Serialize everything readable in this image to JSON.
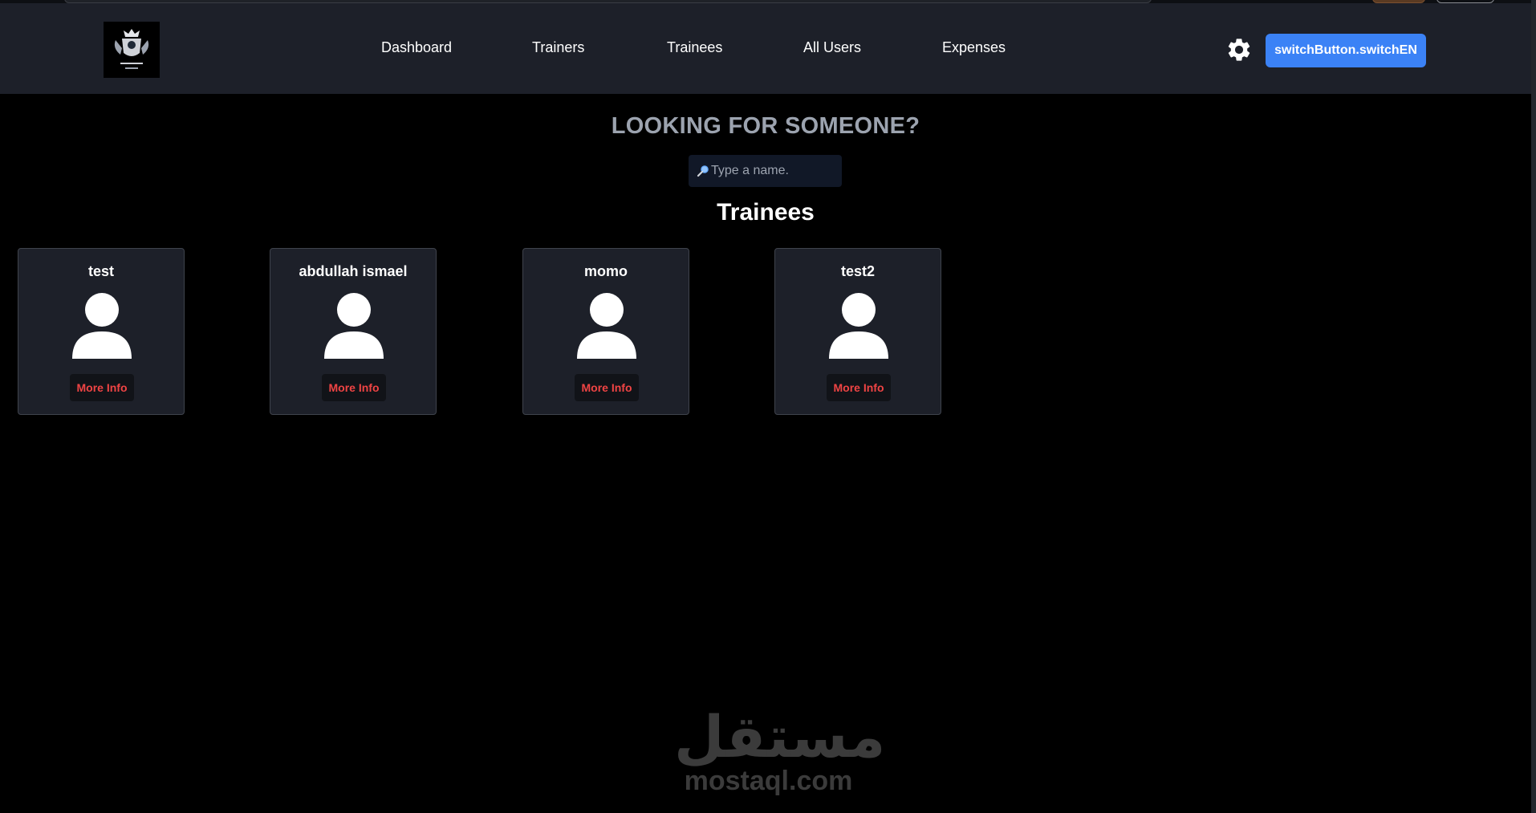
{
  "nav": {
    "links": [
      {
        "label": "Dashboard"
      },
      {
        "label": "Trainers"
      },
      {
        "label": "Trainees"
      },
      {
        "label": "All Users"
      },
      {
        "label": "Expenses"
      }
    ],
    "switch_button": "switchButton.switchEN",
    "icons": {
      "settings": "gear-icon",
      "logo": "gym-logo"
    }
  },
  "search": {
    "heading": "LOOKING FOR SOMEONE?",
    "placeholder": "Type a name.",
    "icon": "magnifier-icon"
  },
  "section_title": "Trainees",
  "trainees": [
    {
      "name": "test",
      "button": "More Info"
    },
    {
      "name": "abdullah ismael",
      "button": "More Info"
    },
    {
      "name": "momo",
      "button": "More Info"
    },
    {
      "name": "test2",
      "button": "More Info"
    }
  ],
  "watermark": {
    "arabic": "مستقل",
    "latin": "mostaql.com"
  },
  "colors": {
    "page_bg": "#000000",
    "nav_bg": "#1d2029",
    "card_bg": "#1d2029",
    "accent_button": "#3b82f6",
    "more_info_text": "#ef4444",
    "heading_gray": "#9ca3af"
  }
}
